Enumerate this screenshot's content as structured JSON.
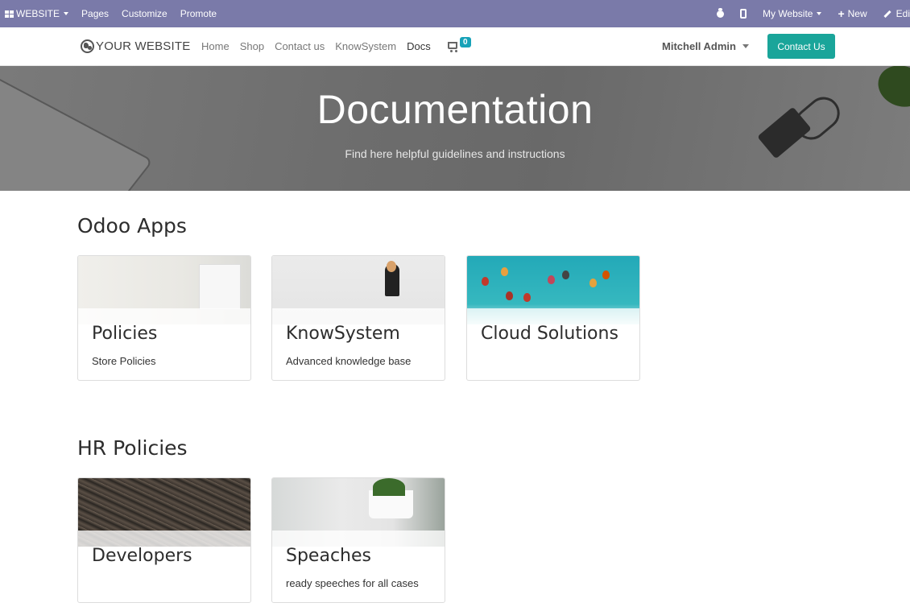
{
  "admin_bar": {
    "brand": "WEBSITE",
    "menus": [
      "Pages",
      "Customize",
      "Promote"
    ],
    "site_selector": "My Website",
    "new_label": "New",
    "edit_label": "Edi"
  },
  "navbar": {
    "logo_text": "YOUR WEBSITE",
    "links": [
      "Home",
      "Shop",
      "Contact us",
      "KnowSystem",
      "Docs"
    ],
    "cart_count": "0",
    "user": "Mitchell Admin",
    "contact_button": "Contact Us"
  },
  "hero": {
    "title": "Documentation",
    "subtitle": "Find here helpful guidelines and instructions"
  },
  "sections": [
    {
      "title": "Odoo Apps",
      "cards": [
        {
          "title": "Policies",
          "description": "Store Policies"
        },
        {
          "title": "KnowSystem",
          "description": "Advanced knowledge base"
        },
        {
          "title": "Cloud Solutions",
          "description": ""
        }
      ]
    },
    {
      "title": "HR Policies",
      "cards": [
        {
          "title": "Developers",
          "description": ""
        },
        {
          "title": "Speaches",
          "description": "ready speeches for all cases"
        }
      ]
    }
  ],
  "colors": {
    "admin_bar": "#7a7aa9",
    "contact_button": "#1aa59a",
    "cart_badge": "#17a2b8"
  }
}
